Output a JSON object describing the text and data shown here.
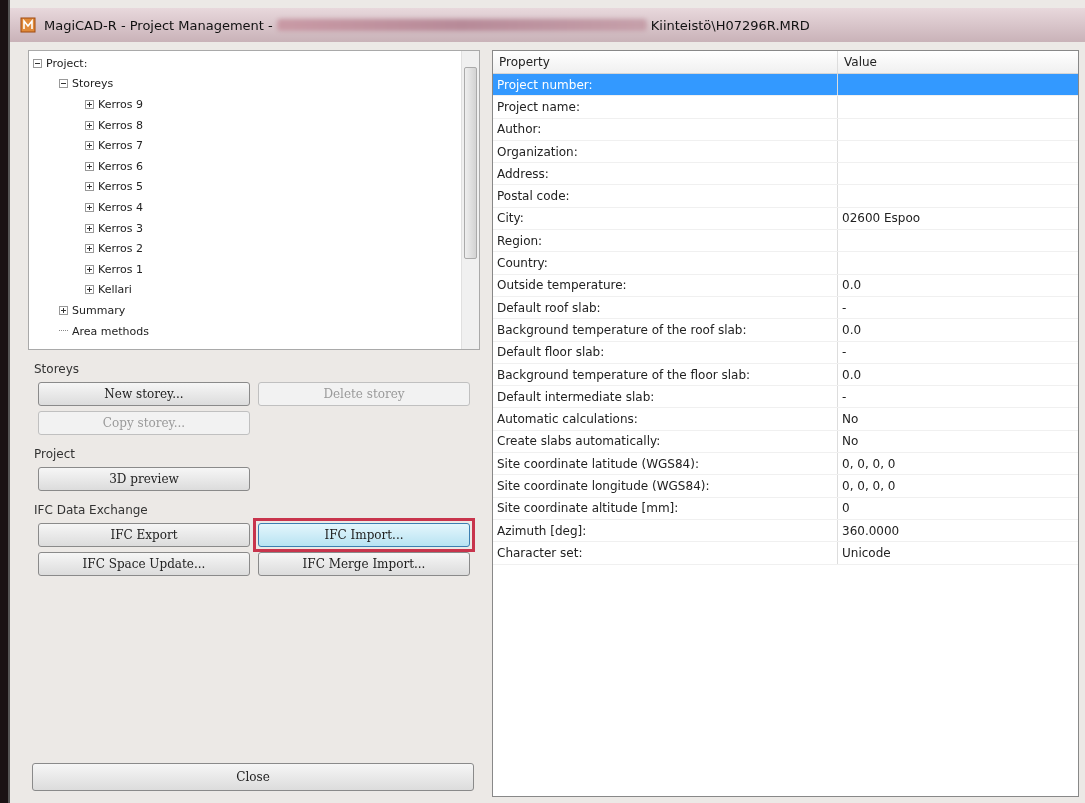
{
  "window": {
    "title": "MagiCAD-R - Project Management -",
    "title_path_end": "Kiinteistö\\H07296R.MRD"
  },
  "tree": [
    {
      "label": "Project:",
      "expanded": true,
      "children": [
        {
          "label": "Storeys",
          "expanded": true,
          "children": [
            {
              "label": "Kerros 9",
              "expanded": false
            },
            {
              "label": "Kerros 8",
              "expanded": false
            },
            {
              "label": "Kerros 7",
              "expanded": false
            },
            {
              "label": "Kerros 6",
              "expanded": false
            },
            {
              "label": "Kerros 5",
              "expanded": false
            },
            {
              "label": "Kerros 4",
              "expanded": false
            },
            {
              "label": "Kerros 3",
              "expanded": false
            },
            {
              "label": "Kerros 2",
              "expanded": false
            },
            {
              "label": "Kerros 1",
              "expanded": false
            },
            {
              "label": "Kellari",
              "expanded": false
            }
          ]
        },
        {
          "label": "Summary",
          "expanded": false
        },
        {
          "label": "Area methods"
        }
      ]
    }
  ],
  "groups": [
    {
      "title": "Storeys",
      "buttons": [
        {
          "label": "New storey...",
          "disabled": false,
          "highlighted": false
        },
        {
          "label": "Delete storey",
          "disabled": true,
          "highlighted": false
        },
        {
          "label": "Copy storey...",
          "disabled": true,
          "highlighted": false
        }
      ]
    },
    {
      "title": "Project",
      "buttons": [
        {
          "label": "3D preview",
          "disabled": false,
          "highlighted": false
        }
      ]
    },
    {
      "title": "IFC  Data  Exchange",
      "buttons": [
        {
          "label": "IFC Export",
          "disabled": false,
          "highlighted": false
        },
        {
          "label": "IFC Import...",
          "disabled": false,
          "highlighted": true
        },
        {
          "label": "IFC Space Update...",
          "disabled": false,
          "highlighted": false
        },
        {
          "label": "IFC Merge Import...",
          "disabled": false,
          "highlighted": false
        }
      ]
    }
  ],
  "close_button": "Close",
  "table": {
    "columns": [
      "Property",
      "Value"
    ],
    "rows": [
      {
        "property": "Project number:",
        "selected": true
      },
      {
        "property": "Project name:",
        "selected": false
      },
      {
        "property": "Author:",
        "selected": false
      },
      {
        "property": "Organization:",
        "selected": false
      },
      {
        "property": "Address:",
        "selected": false
      },
      {
        "property": "Postal code:",
        "selected": false
      },
      {
        "property": "City:",
        "value": "02600 Espoo",
        "selected": false
      },
      {
        "property": "Region:",
        "selected": false
      },
      {
        "property": "Country:",
        "selected": false
      },
      {
        "property": "Outside temperature:",
        "value": "0.0",
        "selected": false
      },
      {
        "property": "Default roof slab:",
        "value": "-",
        "selected": false
      },
      {
        "property": "Background temperature of the roof slab:",
        "value": "0.0",
        "selected": false
      },
      {
        "property": "Default floor slab:",
        "value": "-",
        "selected": false
      },
      {
        "property": "Background temperature of the floor slab:",
        "value": "0.0",
        "selected": false
      },
      {
        "property": "Default intermediate slab:",
        "value": "-",
        "selected": false
      },
      {
        "property": "Automatic calculations:",
        "value": "No",
        "selected": false
      },
      {
        "property": "Create slabs automatically:",
        "value": "No",
        "selected": false
      },
      {
        "property": "Site coordinate latitude (WGS84):",
        "value": "0, 0, 0, 0",
        "selected": false
      },
      {
        "property": "Site coordinate longitude (WGS84):",
        "value": "0, 0, 0, 0",
        "selected": false
      },
      {
        "property": "Site coordinate altitude [mm]:",
        "value": "0",
        "selected": false
      },
      {
        "property": "Azimuth [deg]:",
        "value": "360.0000",
        "selected": false
      },
      {
        "property": "Character set:",
        "value": "Unicode",
        "selected": false
      }
    ]
  }
}
